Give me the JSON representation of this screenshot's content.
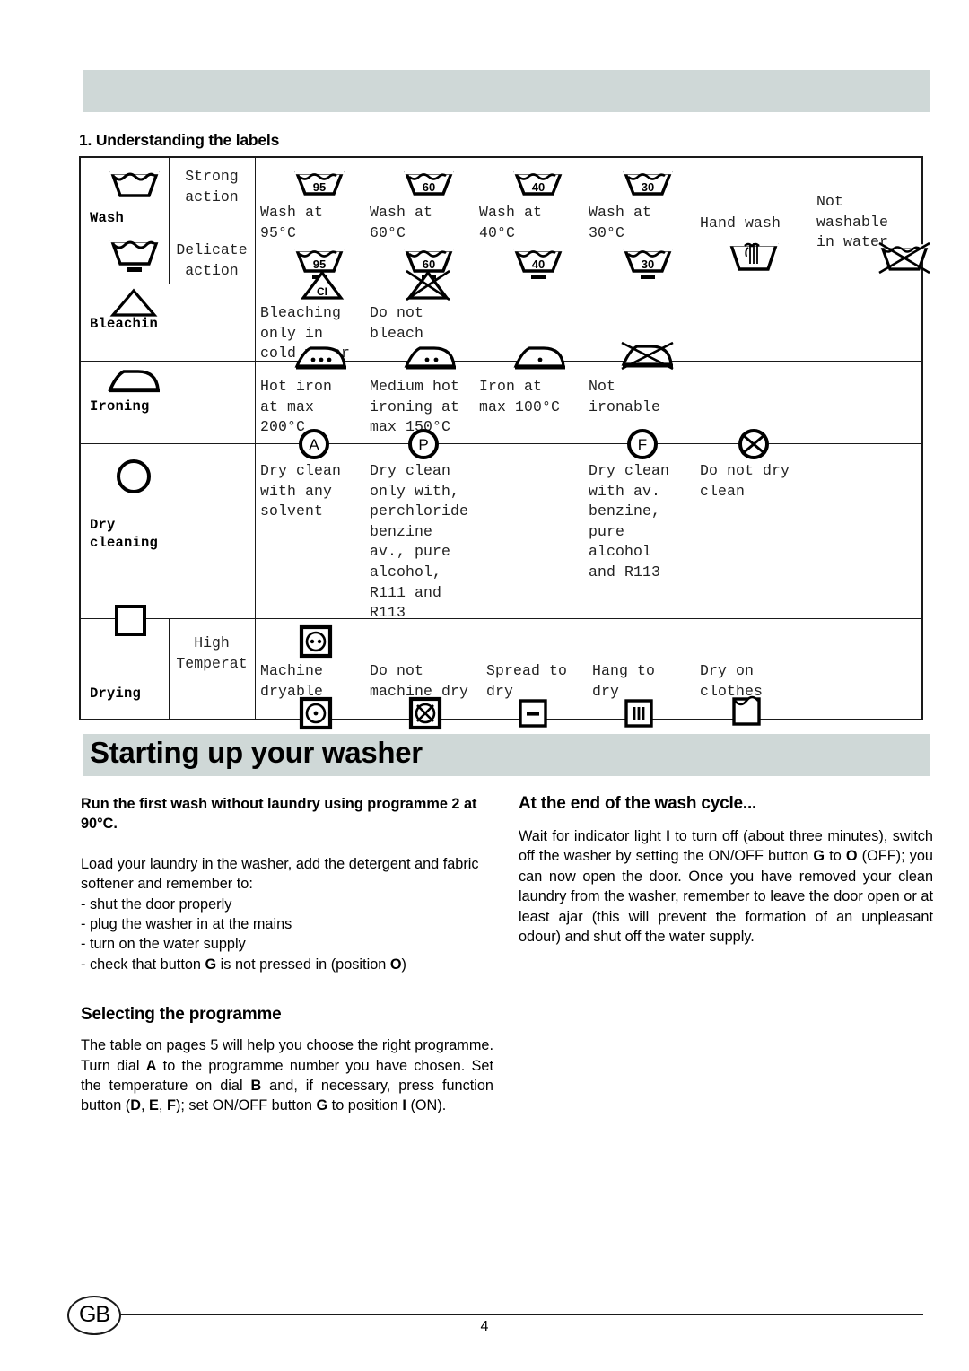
{
  "section": {
    "number_title": "1. Understanding the labels"
  },
  "label_table": {
    "rows": [
      {
        "key": "wash",
        "label": "Wash",
        "left_icons": [
          "wash-tub-icon",
          "wash-tub-delicate-icon"
        ],
        "modes": [
          "Strong\naction",
          "Delicate\naction"
        ],
        "cells": [
          {
            "text": "Wash at\n95°C",
            "icon_top": "tub-95-icon",
            "icon_bottom": "tub-95-delicate-icon"
          },
          {
            "text": "Wash at\n60°C",
            "icon_top": "tub-60-icon",
            "icon_bottom": "tub-60-delicate-icon"
          },
          {
            "text": "Wash at\n40°C",
            "icon_top": "tub-40-icon",
            "icon_bottom": "tub-40-delicate-icon"
          },
          {
            "text": "Wash at\n30°C",
            "icon_top": "tub-30-icon",
            "icon_bottom": "tub-30-delicate-icon"
          },
          {
            "text": "Hand wash",
            "icon_top": "",
            "icon_bottom": "hand-wash-icon"
          },
          {
            "text": "Not\nwashable\nin water",
            "icon_top": "",
            "icon_bottom": "no-wash-icon"
          }
        ]
      },
      {
        "key": "bleaching",
        "label": "Bleachin",
        "left_icons": [
          "bleach-triangle-icon"
        ],
        "modes": [],
        "cells": [
          {
            "text": "Bleaching\nonly in\ncold water",
            "icon_top": "bleach-cl-icon",
            "icon_bottom": ""
          },
          {
            "text": "Do not\nbleach",
            "icon_top": "no-bleach-icon",
            "icon_bottom": ""
          }
        ]
      },
      {
        "key": "ironing",
        "label": "Ironing",
        "left_icons": [
          "iron-icon"
        ],
        "modes": [],
        "cells": [
          {
            "text": "Hot iron\nat max\n200°C",
            "icon_top": "iron-3-dots-icon",
            "icon_bottom": ""
          },
          {
            "text": "Medium hot\nironing at\nmax 150°C",
            "icon_top": "iron-2-dots-icon",
            "icon_bottom": ""
          },
          {
            "text": "Iron at\nmax 100°C",
            "icon_top": "iron-1-dot-icon",
            "icon_bottom": ""
          },
          {
            "text": "Not\nironable",
            "icon_top": "no-iron-icon",
            "icon_bottom": ""
          }
        ]
      },
      {
        "key": "dry_cleaning",
        "label": "Dry\ncleaning",
        "left_icons": [
          "dryclean-circle-icon",
          "square-icon"
        ],
        "modes": [],
        "cells": [
          {
            "text": "Dry clean\nwith any\nsolvent",
            "icon_top": "circle-a-icon",
            "icon_bottom": ""
          },
          {
            "text": "Dry clean\nonly with,\nperchloride\nbenzine\nav., pure\nalcohol,\nR111 and\nR113",
            "icon_top": "circle-p-icon",
            "icon_bottom": ""
          },
          {
            "text": "Dry clean\nwith av.\nbenzine,\npure\nalcohol\nand R113",
            "icon_top": "circle-f-icon",
            "icon_bottom": ""
          },
          {
            "text": "Do not dry\nclean",
            "icon_top": "no-dryclean-icon",
            "icon_bottom": ""
          }
        ]
      },
      {
        "key": "drying",
        "label": "Drying",
        "left_icons": [],
        "modes": [
          "High\nTemperat"
        ],
        "cells": [
          {
            "text": "Machine\ndryable",
            "icon_top": "tumble-high-icon",
            "icon_bottom": "tumble-low-icon"
          },
          {
            "text": "Do not\nmachine dry",
            "icon_top": "",
            "icon_bottom": "no-tumble-icon"
          },
          {
            "text": "Spread to\ndry",
            "icon_top": "",
            "icon_bottom": "flat-dry-icon"
          },
          {
            "text": "Hang to\ndry",
            "icon_top": "",
            "icon_bottom": "line-dry-icon"
          },
          {
            "text": "Dry on\nclothes",
            "icon_top": "",
            "icon_bottom": "drip-dry-icon"
          }
        ]
      }
    ]
  },
  "main_title": "Starting up your washer",
  "left_column": {
    "lead": "Run the first wash without laundry using programme 2 at  90°C.",
    "intro": "Load your laundry in the washer, add the detergent and fabric softener and remember to:",
    "bullets": [
      "- shut the door properly",
      "- plug the washer in at the mains",
      "- turn on the water supply"
    ],
    "bullet_last_pre": "- check that button ",
    "bullet_last_b1": "G",
    "bullet_last_mid": " is not pressed in (position ",
    "bullet_last_b2": "O",
    "bullet_last_end": ")",
    "subheading": "Selecting the programme",
    "para_1": "The table on pages 5 will help you choose the right programme. Turn dial ",
    "para_b1": "A",
    "para_2": " to the programme number you have chosen. Set the temperature on dial ",
    "para_b2": "B",
    "para_3": " and, if necessary, press function button (",
    "para_b3": "D",
    "para_4": ", ",
    "para_b4": "E",
    "para_5": ", ",
    "para_b5": "F",
    "para_6": "); set ON/OFF button ",
    "para_b6": "G",
    "para_7": " to position ",
    "para_b7": "I",
    "para_8": " (ON)."
  },
  "right_column": {
    "heading": "At the end of the wash cycle...",
    "p1": "Wait for indicator light ",
    "b1": "I",
    "p2": " to turn off (about three minutes), switch off the washer by setting the ON/OFF button ",
    "b2": "G",
    "p3": " to ",
    "b3": "O",
    "p4": " (OFF); you can now open the door. Once you have removed your clean laundry from the washer, remember to leave the door open or at least ajar (this will prevent the formation of an unpleasant odour) and shut off the water supply."
  },
  "footer": {
    "locale": "GB",
    "page_number": "4"
  },
  "colors": {
    "banner_grey": "#cfd8d7",
    "rule": "#1a1a1a"
  }
}
